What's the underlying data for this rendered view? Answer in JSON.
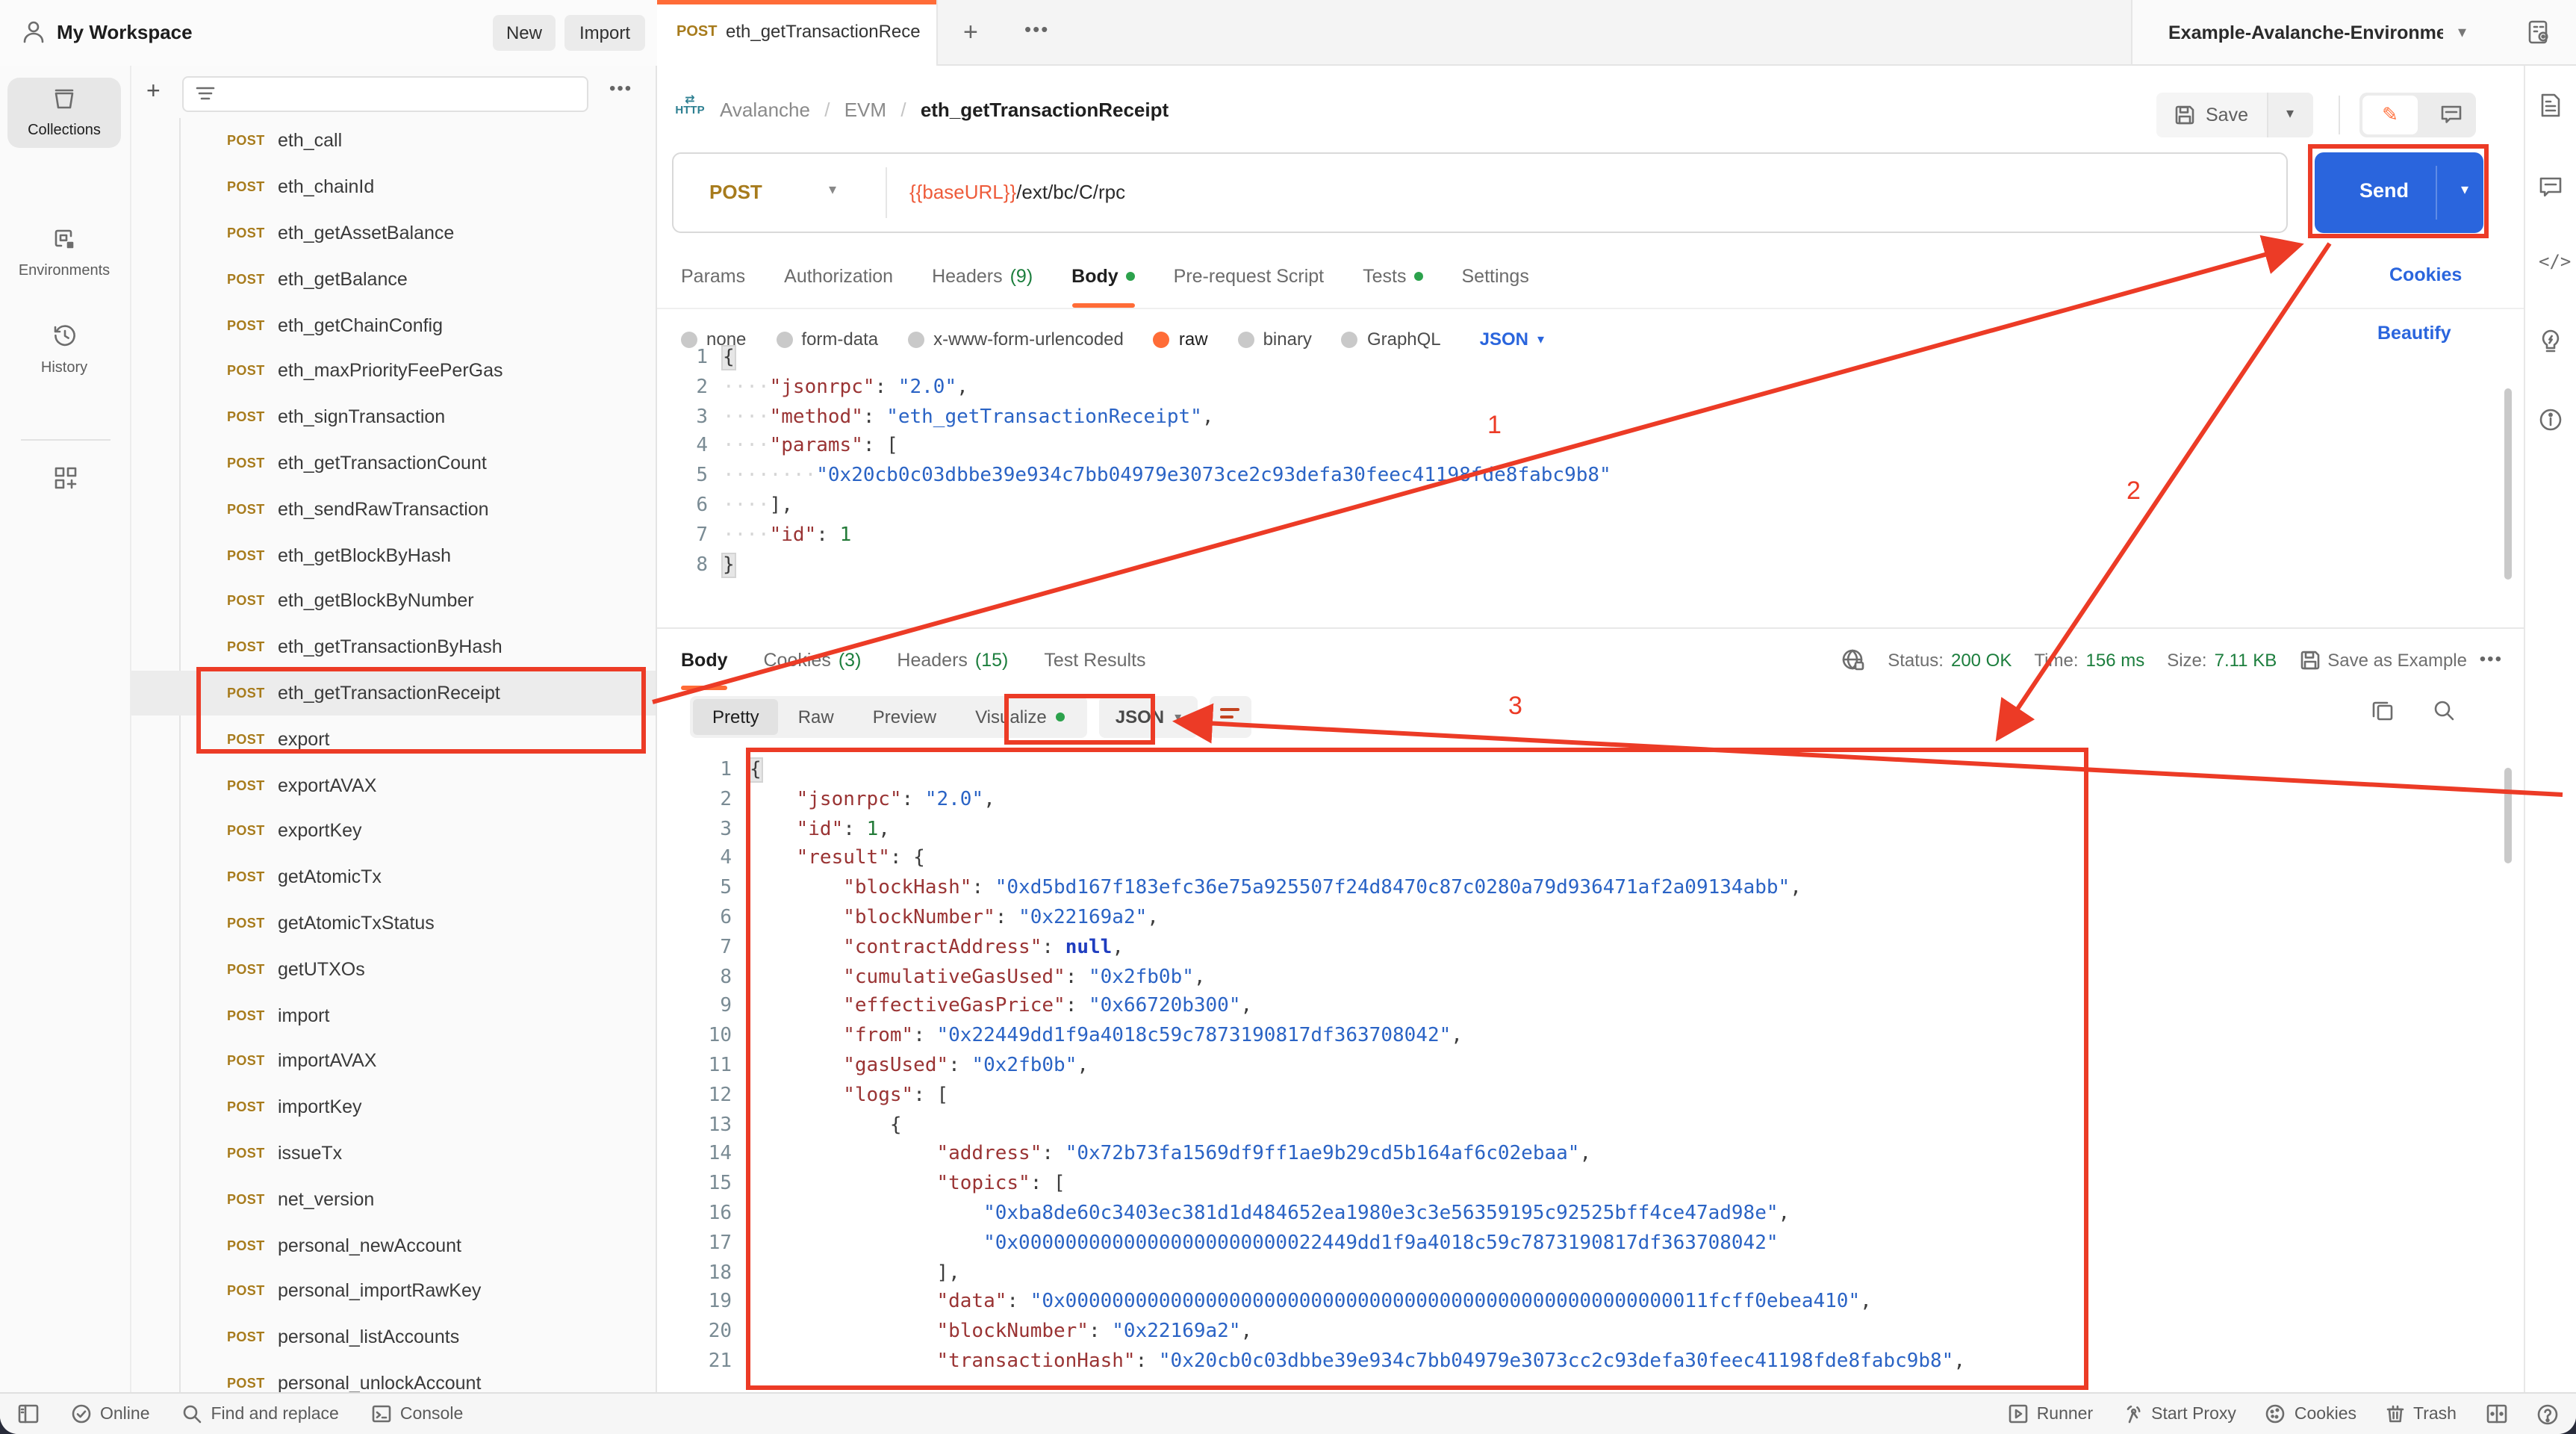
{
  "workspace": {
    "title": "My Workspace",
    "new_label": "New",
    "import_label": "Import"
  },
  "tabs": {
    "active": {
      "method": "POST",
      "title": "eth_getTransactionRece"
    }
  },
  "environment": {
    "selected": "Example-Avalanche-Environme"
  },
  "rail": {
    "items": [
      {
        "label": "Collections"
      },
      {
        "label": "Environments"
      },
      {
        "label": "History"
      }
    ]
  },
  "sidebar": {
    "items": [
      {
        "method": "POST",
        "name": "eth_call"
      },
      {
        "method": "POST",
        "name": "eth_chainId"
      },
      {
        "method": "POST",
        "name": "eth_getAssetBalance"
      },
      {
        "method": "POST",
        "name": "eth_getBalance"
      },
      {
        "method": "POST",
        "name": "eth_getChainConfig"
      },
      {
        "method": "POST",
        "name": "eth_maxPriorityFeePerGas"
      },
      {
        "method": "POST",
        "name": "eth_signTransaction"
      },
      {
        "method": "POST",
        "name": "eth_getTransactionCount"
      },
      {
        "method": "POST",
        "name": "eth_sendRawTransaction"
      },
      {
        "method": "POST",
        "name": "eth_getBlockByHash"
      },
      {
        "method": "POST",
        "name": "eth_getBlockByNumber"
      },
      {
        "method": "POST",
        "name": "eth_getTransactionByHash"
      },
      {
        "method": "POST",
        "name": "eth_getTransactionReceipt",
        "selected": true
      },
      {
        "method": "POST",
        "name": "export"
      },
      {
        "method": "POST",
        "name": "exportAVAX"
      },
      {
        "method": "POST",
        "name": "exportKey"
      },
      {
        "method": "POST",
        "name": "getAtomicTx"
      },
      {
        "method": "POST",
        "name": "getAtomicTxStatus"
      },
      {
        "method": "POST",
        "name": "getUTXOs"
      },
      {
        "method": "POST",
        "name": "import"
      },
      {
        "method": "POST",
        "name": "importAVAX"
      },
      {
        "method": "POST",
        "name": "importKey"
      },
      {
        "method": "POST",
        "name": "issueTx"
      },
      {
        "method": "POST",
        "name": "net_version"
      },
      {
        "method": "POST",
        "name": "personal_newAccount"
      },
      {
        "method": "POST",
        "name": "personal_importRawKey"
      },
      {
        "method": "POST",
        "name": "personal_listAccounts"
      },
      {
        "method": "POST",
        "name": "personal_unlockAccount"
      }
    ]
  },
  "request": {
    "breadcrumb": {
      "collection": "Avalanche",
      "separator": "/",
      "folder": "EVM",
      "name": "eth_getTransactionReceipt"
    },
    "save_label": "Save",
    "method": "POST",
    "url": {
      "variable": "{{baseURL}}",
      "path": "/ext/bc/C/rpc"
    },
    "send_label": "Send",
    "tabs": [
      {
        "label": "Params"
      },
      {
        "label": "Authorization"
      },
      {
        "label": "Headers",
        "badge": "(9)"
      },
      {
        "label": "Body",
        "dot": true,
        "active": true
      },
      {
        "label": "Pre-request Script"
      },
      {
        "label": "Tests",
        "dot": true
      },
      {
        "label": "Settings"
      }
    ],
    "cookies_link": "Cookies",
    "beautify_link": "Beautify",
    "body_modes": [
      {
        "label": "none"
      },
      {
        "label": "form-data"
      },
      {
        "label": "x-www-form-urlencoded"
      },
      {
        "label": "raw",
        "selected": true
      },
      {
        "label": "binary"
      },
      {
        "label": "GraphQL"
      }
    ],
    "language": "JSON",
    "editor_lines": [
      "{",
      "    \"jsonrpc\": \"2.0\",",
      "    \"method\": \"eth_getTransactionReceipt\",",
      "    \"params\": [",
      "        \"0x20cb0c03dbbe39e934c7bb04979e3073ce2c93defa30feec41198fde8fabc9b8\"",
      "    ],",
      "    \"id\": 1",
      "}"
    ]
  },
  "response": {
    "tabs": [
      {
        "label": "Body",
        "active": true
      },
      {
        "label": "Cookies",
        "badge": "(3)"
      },
      {
        "label": "Headers",
        "badge": "(15)"
      },
      {
        "label": "Test Results"
      }
    ],
    "status": {
      "label": "Status:",
      "value": "200 OK"
    },
    "time": {
      "label": "Time:",
      "value": "156 ms"
    },
    "size": {
      "label": "Size:",
      "value": "7.11 KB"
    },
    "save_as_example": "Save as Example",
    "view_tabs": [
      {
        "label": "Pretty",
        "active": true
      },
      {
        "label": "Raw"
      },
      {
        "label": "Preview"
      },
      {
        "label": "Visualize",
        "dot": true
      }
    ],
    "format": "JSON",
    "editor_lines": [
      "{",
      "    \"jsonrpc\": \"2.0\",",
      "    \"id\": 1,",
      "    \"result\": {",
      "        \"blockHash\": \"0xd5bd167f183efc36e75a925507f24d8470c87c0280a79d936471af2a09134abb\",",
      "        \"blockNumber\": \"0x22169a2\",",
      "        \"contractAddress\": null,",
      "        \"cumulativeGasUsed\": \"0x2fb0b\",",
      "        \"effectiveGasPrice\": \"0x66720b300\",",
      "        \"from\": \"0x22449dd1f9a4018c59c7873190817df363708042\",",
      "        \"gasUsed\": \"0x2fb0b\",",
      "        \"logs\": [",
      "            {",
      "                \"address\": \"0x72b73fa1569df9ff1ae9b29cd5b164af6c02ebaa\",",
      "                \"topics\": [",
      "                    \"0xba8de60c3403ec381d1d484652ea1980e3c3e56359195c92525bff4ce47ad98e\",",
      "                    \"0x00000000000000000000000022449dd1f9a4018c59c7873190817df363708042\"",
      "                ],",
      "                \"data\": \"0x0000000000000000000000000000000000000000000000000000011fcff0ebea410\",",
      "                \"blockNumber\": \"0x22169a2\",",
      "                \"transactionHash\": \"0x20cb0c03dbbe39e934c7bb04979e3073cc2c93defa30feec41198fde8fabc9b8\","
    ]
  },
  "statusbar": {
    "online": "Online",
    "find": "Find and replace",
    "console": "Console",
    "runner": "Runner",
    "proxy": "Start Proxy",
    "cookies": "Cookies",
    "trash": "Trash"
  },
  "annotations": {
    "step1": "1",
    "step2": "2",
    "step3": "3"
  },
  "colors": {
    "accent_orange": "#ff6c37",
    "send_blue": "#2a65dd",
    "annotation_red": "#ec3b26",
    "status_green": "#1c7e3d",
    "method_post_amber": "#a77b1c"
  }
}
